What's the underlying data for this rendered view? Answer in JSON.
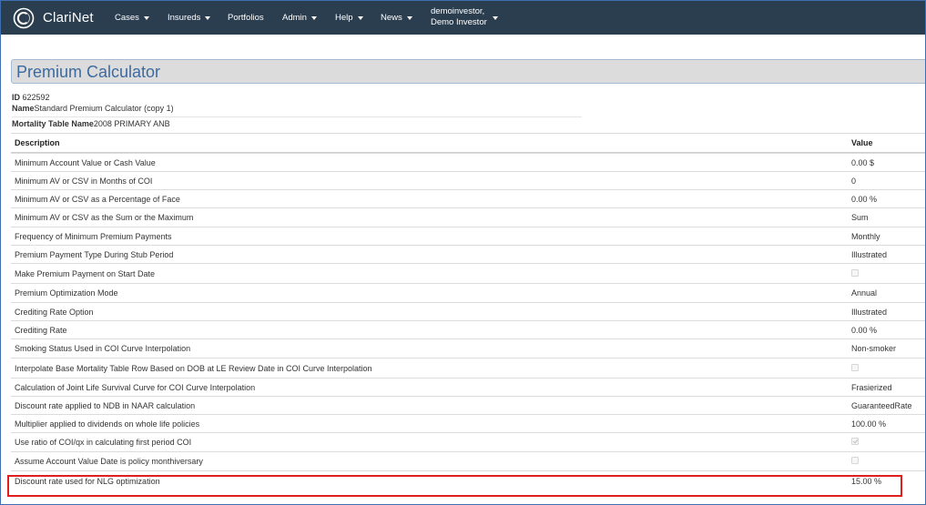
{
  "app": {
    "brand": "ClariNet"
  },
  "nav": {
    "items": [
      {
        "label": "Cases",
        "dropdown": true
      },
      {
        "label": "Insureds",
        "dropdown": true
      },
      {
        "label": "Portfolios",
        "dropdown": false
      },
      {
        "label": "Admin",
        "dropdown": true
      },
      {
        "label": "Help",
        "dropdown": true
      },
      {
        "label": "News",
        "dropdown": true
      }
    ],
    "user_line1": "demoinvestor,",
    "user_line2": "Demo Investor"
  },
  "page": {
    "title": "Premium Calculator",
    "id_label": "ID",
    "id_value": "622592",
    "name_label": "Name",
    "name_value": "Standard Premium Calculator (copy 1)",
    "mortality_label": "Mortality Table Name",
    "mortality_value": "2008 PRIMARY ANB"
  },
  "table": {
    "headers": {
      "description": "Description",
      "value": "Value"
    },
    "rows": [
      {
        "description": "Minimum Account Value or Cash Value",
        "value": "0.00 $"
      },
      {
        "description": "Minimum AV or CSV in Months of COI",
        "value": "0"
      },
      {
        "description": "Minimum AV or CSV as a Percentage of Face",
        "value": "0.00 %"
      },
      {
        "description": "Minimum AV or CSV as the Sum or the Maximum",
        "value": "Sum"
      },
      {
        "description": "Frequency of Minimum Premium Payments",
        "value": "Monthly"
      },
      {
        "description": "Premium Payment Type During Stub Period",
        "value": "Illustrated"
      },
      {
        "description": "Make Premium Payment on Start Date",
        "checkbox": true,
        "checked": false
      },
      {
        "description": "Premium Optimization Mode",
        "value": "Annual"
      },
      {
        "description": "Crediting Rate Option",
        "value": "Illustrated"
      },
      {
        "description": "Crediting Rate",
        "value": "0.00 %"
      },
      {
        "description": "Smoking Status Used in COI Curve Interpolation",
        "value": "Non-smoker"
      },
      {
        "description": "Interpolate Base Mortality Table Row Based on DOB at LE Review Date in COI Curve Interpolation",
        "checkbox": true,
        "checked": false
      },
      {
        "description": "Calculation of Joint Life Survival Curve for COI Curve Interpolation",
        "value": "Frasierized"
      },
      {
        "description": "Discount rate applied to NDB in NAAR calculation",
        "value": "GuaranteedRate"
      },
      {
        "description": "Multiplier applied to dividends on whole life policies",
        "value": "100.00 %"
      },
      {
        "description": "Use ratio of COI/qx in calculating first period COI",
        "checkbox": true,
        "checked": true
      },
      {
        "description": "Assume Account Value Date is policy monthiversary",
        "checkbox": true,
        "checked": false
      },
      {
        "description": "Discount rate used for NLG optimization",
        "value": "15.00 %"
      }
    ]
  },
  "colors": {
    "navbar": "#2b3e50",
    "title": "#3d6aa0",
    "highlight": "#e01e1e"
  }
}
